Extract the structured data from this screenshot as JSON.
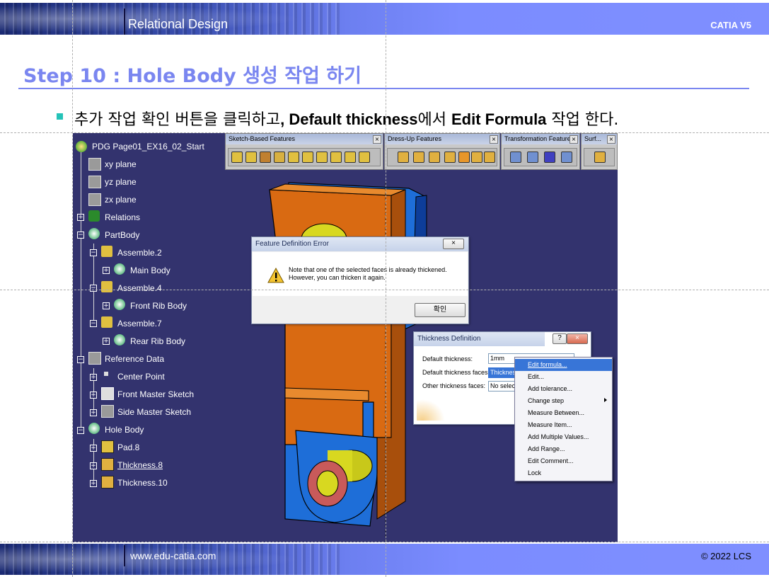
{
  "header": {
    "left_title": "Relational Design",
    "right_title": "CATIA V5"
  },
  "footer": {
    "website": "www.edu-catia.com",
    "copyright": "© 2022 LCS"
  },
  "slide": {
    "title": "Step 10 : Hole Body 생성 작업 하기",
    "instruction": {
      "pre": "추가 작업 확인 버튼을 클릭하고",
      "bold1": ", Default thickness",
      "mid": "에서 ",
      "bold2": "Edit Formula",
      "post": " 작업 한다."
    }
  },
  "tree": {
    "root": "PDG Page01_EX16_02_Start",
    "items": [
      "xy plane",
      "yz plane",
      "zx plane",
      "Relations",
      "PartBody",
      "Assemble.2",
      "Main Body",
      "Assemble.4",
      "Front Rib Body",
      "Assemble.7",
      "Rear Rib Body",
      "Reference Data",
      "Center Point",
      "Front Master Sketch",
      "Side Master Sketch",
      "Hole Body",
      "Pad.8",
      "Thickness.8",
      "Thickness.10"
    ]
  },
  "toolbars": [
    {
      "title": "Sketch-Based Features"
    },
    {
      "title": "Dress-Up Features"
    },
    {
      "title": "Transformation Features"
    },
    {
      "title": "Surf..."
    }
  ],
  "error_dialog": {
    "title": "Feature Definition Error",
    "message_line1": "Note that one of the selected faces is already thickened.",
    "message_line2": "However, you can thicken it again.",
    "ok_label": "확인"
  },
  "thickness_dialog": {
    "title": "Thickness Definition",
    "help": "?",
    "default_thickness_label": "Default thickness:",
    "default_thickness_value": "1mm",
    "default_faces_label": "Default thickness faces:",
    "default_faces_value": "Thickness",
    "other_faces_label": "Other thickness faces:",
    "other_faces_value": "No selec"
  },
  "context_menu": {
    "items": [
      "Edit formula...",
      "Edit...",
      "Add tolerance...",
      "Change step",
      "Measure Between...",
      "Measure Item...",
      "Add Multiple Values...",
      "Add Range...",
      "Edit Comment...",
      "Lock"
    ],
    "highlighted": "Edit formula..."
  },
  "colors": {
    "title_blue": "#7a86f0",
    "viewport_bg": "#33336e",
    "part_orange": "#d96a12",
    "part_blue": "#1e6ed8",
    "bushing_yellow": "#d8d820",
    "menu_highlight": "#3875d7"
  }
}
